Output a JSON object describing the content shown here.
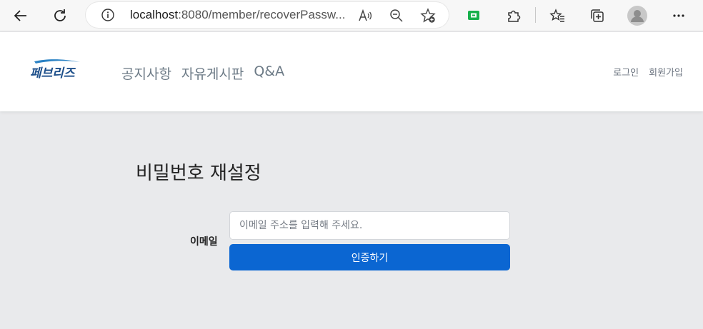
{
  "browser": {
    "url_host": "localhost",
    "url_rest": ":8080/member/recoverPassw..."
  },
  "header": {
    "logo_text": "페브리즈",
    "nav": [
      {
        "label": "공지사항"
      },
      {
        "label": "자유게시판"
      },
      {
        "label": "Q&A"
      }
    ],
    "util": {
      "login": "로그인",
      "signup": "회원가입"
    }
  },
  "main": {
    "title": "비밀번호 재설정",
    "email_label": "이메일",
    "email_placeholder": "이메일 주소를 입력해 주세요.",
    "email_value": "",
    "verify_button": "인증하기"
  },
  "colors": {
    "primary_button": "#0b66d2",
    "page_background": "#e9eaec",
    "nav_text": "#6c7a86"
  }
}
